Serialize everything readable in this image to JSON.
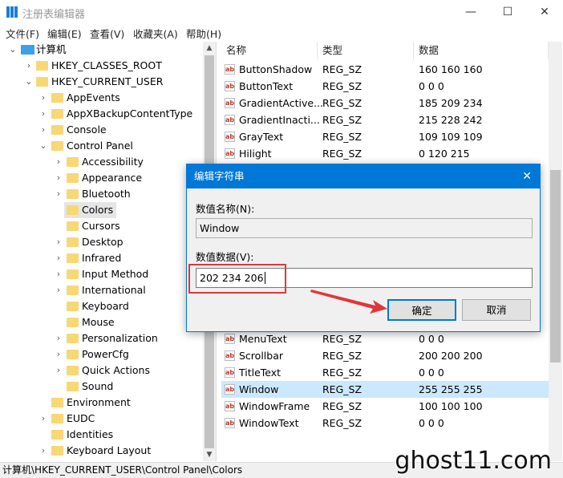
{
  "window": {
    "title": "注册表编辑器",
    "minimize": "—",
    "maximize": "☐",
    "close": "✕"
  },
  "menu": [
    "文件(F)",
    "编辑(E)",
    "查看(V)",
    "收藏夹(A)",
    "帮助(H)"
  ],
  "tree": [
    {
      "label": "计算机",
      "level": 0,
      "chev": "⌄"
    },
    {
      "label": "HKEY_CLASSES_ROOT",
      "level": 1,
      "chev": "›"
    },
    {
      "label": "HKEY_CURRENT_USER",
      "level": 1,
      "chev": "⌄"
    },
    {
      "label": "AppEvents",
      "level": 2,
      "chev": "›"
    },
    {
      "label": "AppXBackupContentType",
      "level": 2,
      "chev": "›"
    },
    {
      "label": "Console",
      "level": 2,
      "chev": "›"
    },
    {
      "label": "Control Panel",
      "level": 2,
      "chev": "⌄"
    },
    {
      "label": "Accessibility",
      "level": 3,
      "chev": "›"
    },
    {
      "label": "Appearance",
      "level": 3,
      "chev": "›"
    },
    {
      "label": "Bluetooth",
      "level": 3,
      "chev": "›"
    },
    {
      "label": "Colors",
      "level": 3,
      "chev": "",
      "selected": true
    },
    {
      "label": "Cursors",
      "level": 3,
      "chev": ""
    },
    {
      "label": "Desktop",
      "level": 3,
      "chev": "›"
    },
    {
      "label": "Infrared",
      "level": 3,
      "chev": "›"
    },
    {
      "label": "Input Method",
      "level": 3,
      "chev": "›"
    },
    {
      "label": "International",
      "level": 3,
      "chev": "›"
    },
    {
      "label": "Keyboard",
      "level": 3,
      "chev": ""
    },
    {
      "label": "Mouse",
      "level": 3,
      "chev": ""
    },
    {
      "label": "Personalization",
      "level": 3,
      "chev": "›"
    },
    {
      "label": "PowerCfg",
      "level": 3,
      "chev": "›"
    },
    {
      "label": "Quick Actions",
      "level": 3,
      "chev": "›"
    },
    {
      "label": "Sound",
      "level": 3,
      "chev": ""
    },
    {
      "label": "Environment",
      "level": 2,
      "chev": ""
    },
    {
      "label": "EUDC",
      "level": 2,
      "chev": "›"
    },
    {
      "label": "Identities",
      "level": 2,
      "chev": ""
    },
    {
      "label": "Keyboard Layout",
      "level": 2,
      "chev": "›"
    }
  ],
  "list": {
    "headers": [
      "名称",
      "类型",
      "数据"
    ],
    "rows": [
      [
        "ButtonShadow",
        "REG_SZ",
        "160 160 160"
      ],
      [
        "ButtonText",
        "REG_SZ",
        "0 0 0"
      ],
      [
        "GradientActive...",
        "REG_SZ",
        "185 209 234"
      ],
      [
        "GradientInacti...",
        "REG_SZ",
        "215 228 242"
      ],
      [
        "GrayText",
        "REG_SZ",
        "109 109 109"
      ],
      [
        "Hilight",
        "REG_SZ",
        "0 120 215"
      ],
      [
        "MenuText",
        "REG_SZ",
        "0 0 0"
      ],
      [
        "Scrollbar",
        "REG_SZ",
        "200 200 200"
      ],
      [
        "TitleText",
        "REG_SZ",
        "0 0 0"
      ],
      [
        "Window",
        "REG_SZ",
        "255 255 255"
      ],
      [
        "WindowFrame",
        "REG_SZ",
        "100 100 100"
      ],
      [
        "WindowText",
        "REG_SZ",
        "0 0 0"
      ]
    ],
    "highlighted": "Window"
  },
  "status": "计算机\\HKEY_CURRENT_USER\\Control Panel\\Colors",
  "dialog": {
    "title": "编辑字符串",
    "name_label": "数值名称(N):",
    "name_value": "Window",
    "data_label": "数值数据(V):",
    "data_value": "202 234 206",
    "ok": "确定",
    "cancel": "取消",
    "close": "✕"
  },
  "watermark": "ghost11.com",
  "colors": {
    "accent": "#0078d7",
    "annotation": "#e0373a",
    "selection": "#cce8ff"
  }
}
